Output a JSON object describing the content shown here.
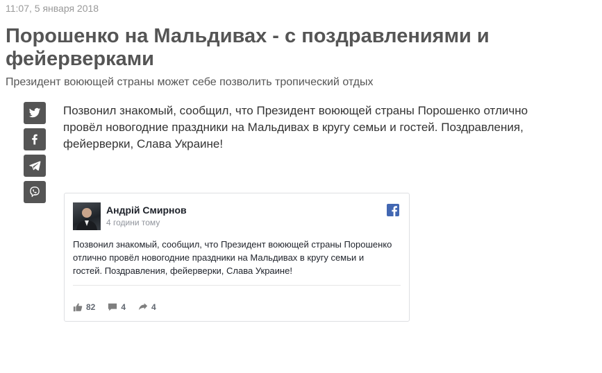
{
  "article": {
    "timestamp": "11:07, 5 января 2018",
    "title": "Порошенко на Мальдивах - с поздравлениями и фейерверками",
    "subtitle": "Президент воюющей страны может себе позволить тропический отдых",
    "body": "Позвонил знакомый, сообщил, что Президент воюющей страны Порошенко отлично провёл новогодние праздники на Мальдивах в кругу семьи и гостей. Поздравления, фейерверки, Слава Украине!"
  },
  "share": {
    "buttons": [
      {
        "icon": "twitter-icon"
      },
      {
        "icon": "facebook-icon"
      },
      {
        "icon": "telegram-icon"
      },
      {
        "icon": "viber-icon"
      }
    ]
  },
  "fb_post": {
    "author": "Андрій Смирнов",
    "time": "4 години тому",
    "text": "Позвонил знакомый, сообщил, что Президент воюющей страны Порошенко отлично провёл новогодние праздники на Мальдивах в кругу семьи и гостей. Поздравления, фейерверки, Слава Украине!",
    "likes": "82",
    "comments": "4",
    "shares": "4"
  },
  "colors": {
    "share_button": "#555555",
    "facebook_blue": "#4267b2"
  }
}
